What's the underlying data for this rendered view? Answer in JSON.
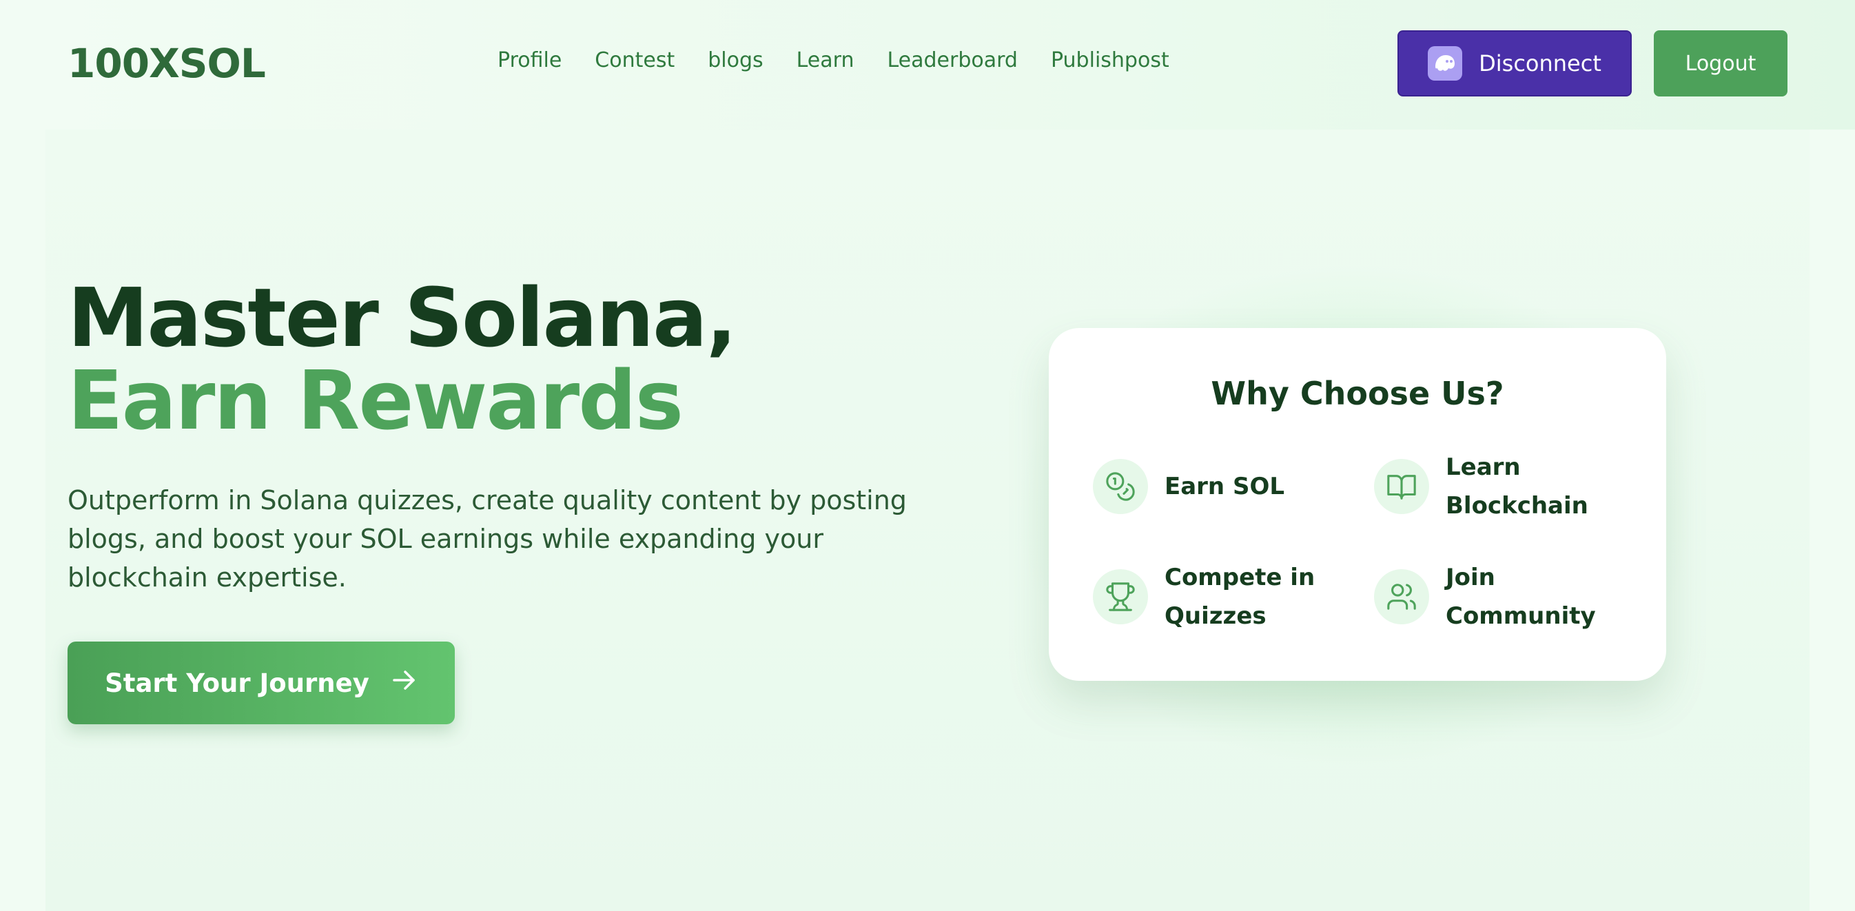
{
  "header": {
    "logo": "100XSOL",
    "nav": [
      "Profile",
      "Contest",
      "blogs",
      "Learn",
      "Leaderboard",
      "Publishpost"
    ],
    "disconnect_label": "Disconnect",
    "logout_label": "Logout"
  },
  "hero": {
    "title_line1": "Master Solana,",
    "title_line2": "Earn Rewards",
    "description": "Outperform in Solana quizzes, create quality content by posting blogs, and boost your SOL earnings while expanding your blockchain expertise.",
    "cta_label": "Start Your Journey"
  },
  "card": {
    "title": "Why Choose Us?",
    "features": [
      {
        "label": "Earn SOL",
        "icon": "coins-icon"
      },
      {
        "label": "Learn Blockchain",
        "icon": "book-icon"
      },
      {
        "label": "Compete in Quizzes",
        "icon": "trophy-icon"
      },
      {
        "label": "Join Community",
        "icon": "users-icon"
      }
    ]
  },
  "colors": {
    "primary_green": "#4ea35b",
    "dark_text": "#163d1f",
    "wallet_purple": "#4a30a8",
    "phantom_lavender": "#ab9ff2"
  }
}
